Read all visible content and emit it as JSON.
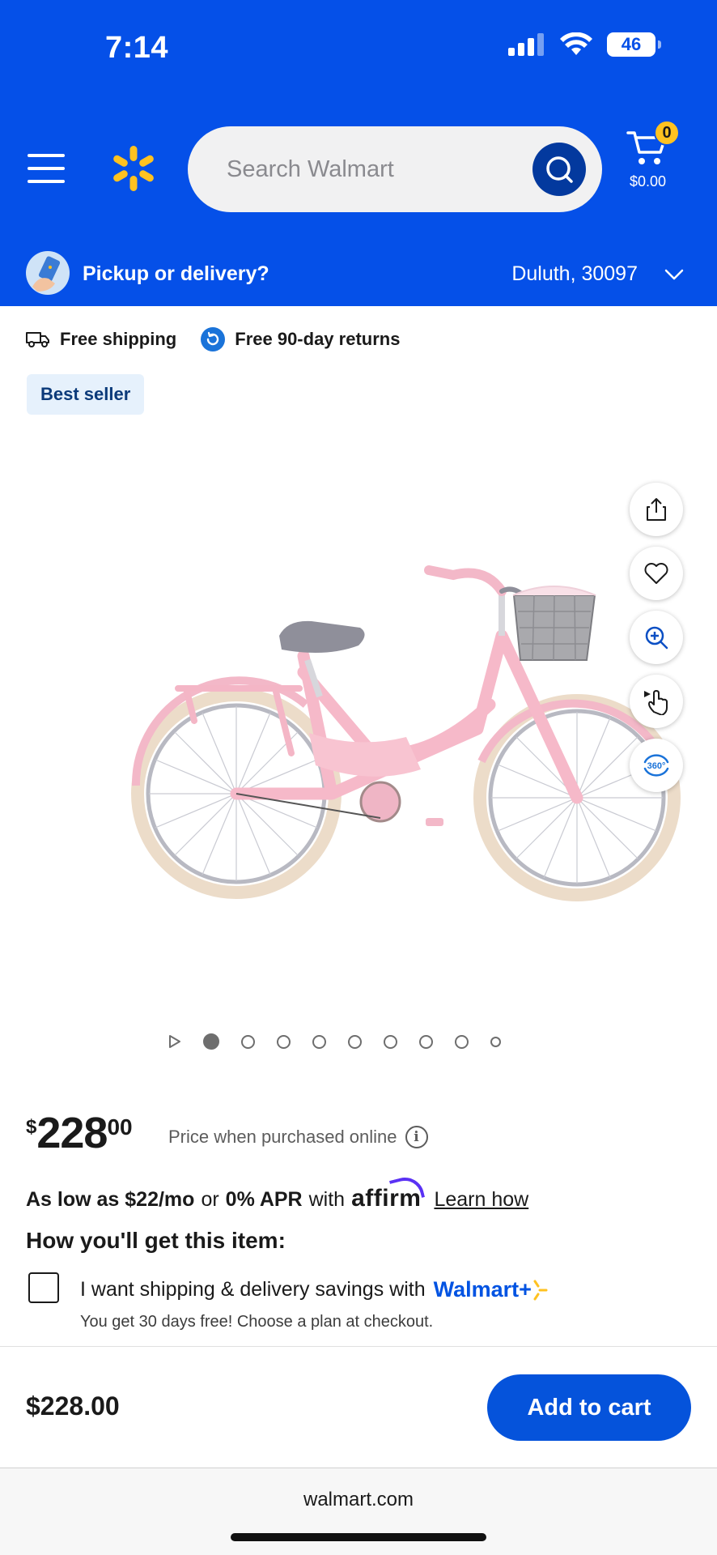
{
  "status_bar": {
    "time": "7:14",
    "battery": "46"
  },
  "header": {
    "search_placeholder": "Search Walmart",
    "cart_count": "0",
    "cart_total": "$0.00",
    "brand_color": "#0550e8",
    "spark_color": "#ffc220"
  },
  "location": {
    "label": "Pickup or delivery?",
    "city": "Duluth, 30097"
  },
  "perks": [
    {
      "icon": "truck-icon",
      "label": "Free shipping"
    },
    {
      "icon": "return-icon",
      "label": "Free 90-day returns"
    }
  ],
  "badge": "Best seller",
  "gallery": {
    "total_dots": 9,
    "active_index": 0
  },
  "price": {
    "currency": "$",
    "whole": "228",
    "cents": "00",
    "note": "Price when purchased online",
    "info": "i"
  },
  "affirm": {
    "prefix": "As low as $22/mo",
    "or": "or",
    "apr": "0% APR",
    "with": "with",
    "brand": "affirm",
    "link": "Learn how"
  },
  "fulfillment": {
    "heading": "How you'll get this item:",
    "checkbox_label": "I want shipping & delivery savings with",
    "plus_brand": "Walmart+",
    "trial_text": "You get 30 days free! Choose a plan at checkout."
  },
  "sticky": {
    "price": "$228.00",
    "button": "Add to cart"
  },
  "browser": {
    "url": "walmart.com"
  }
}
